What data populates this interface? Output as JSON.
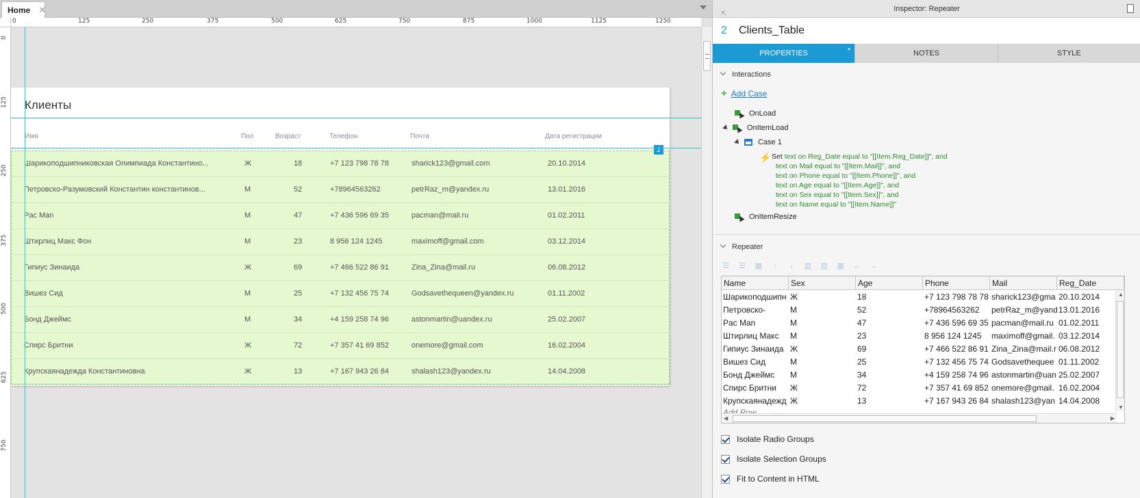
{
  "tabs": {
    "home_label": "Home",
    "close_glyph": "✕"
  },
  "rulers": {
    "horizontal": [
      "0",
      "125",
      "250",
      "375",
      "500",
      "625",
      "750",
      "875",
      "1000",
      "1125",
      "1250"
    ],
    "vertical": [
      "0",
      "125",
      "250",
      "375",
      "500",
      "625",
      "750"
    ]
  },
  "page": {
    "title": "Клиенты",
    "columns": [
      "Имя",
      "Пол",
      "Возраст",
      "Телефон",
      "Почта",
      "Дата регистрации"
    ],
    "badge": "2",
    "rows": [
      {
        "name": "Шарикоподшипниковская Олимпиада Константино...",
        "sex": "Ж",
        "age": "18",
        "phone": "+7 123 798 78 78",
        "mail": "sharick123@gmail.com",
        "date": "20.10.2014"
      },
      {
        "name": "Петровско-Разумовский Константин константинов...",
        "sex": "М",
        "age": "52",
        "phone": "+78964563262",
        "mail": "petrRaz_m@yandex.ru",
        "date": "13.01.2016"
      },
      {
        "name": "Pac Man",
        "sex": "М",
        "age": "47",
        "phone": "+7 436 596 69 35",
        "mail": "pacman@mail.ru",
        "date": "01.02.2011"
      },
      {
        "name": "Штирлиц Макс Фон",
        "sex": "М",
        "age": "23",
        "phone": "8 956 124 1245",
        "mail": "maximoff@gmail.com",
        "date": "03.12.2014"
      },
      {
        "name": "Гипиус Зинаида",
        "sex": "Ж",
        "age": "69",
        "phone": "+7 466 522 86 91",
        "mail": "Zina_Zina@mail.ru",
        "date": "06.08.2012"
      },
      {
        "name": "Вишез Сид",
        "sex": "М",
        "age": "25",
        "phone": "+7 132 456 75 74",
        "mail": "Godsavethequeen@yandex.ru",
        "date": "01.11.2002"
      },
      {
        "name": "Бонд Джеймс",
        "sex": "М",
        "age": "34",
        "phone": "+4 159 258 74 96",
        "mail": "astonmartin@uandex.ru",
        "date": "25.02.2007"
      },
      {
        "name": "Спирс Бритни",
        "sex": "Ж",
        "age": "72",
        "phone": "+7 357 41 69 852",
        "mail": "onemore@gmail.com",
        "date": "16.02.2004"
      },
      {
        "name": "Крупскаянадежда Константиновна",
        "sex": "Ж",
        "age": "13",
        "phone": "+7 167 943 26 84",
        "mail": "shalash123@yandex.ru",
        "date": "14.04.2008"
      }
    ]
  },
  "inspector": {
    "title": "Inspector: Repeater",
    "widget_number": "2",
    "widget_name": "Clients_Table",
    "tabs": [
      "PROPERTIES",
      "NOTES",
      "STYLE"
    ],
    "properties_star": "*",
    "interactions_label": "Interactions",
    "add_case": "Add Case",
    "events": {
      "onload": "OnLoad",
      "onitemload": "OnItemLoad",
      "case1": "Case 1",
      "onitemresize": "OnItemResize"
    },
    "action_set": "Set",
    "action_lines": [
      "text on Reg_Date equal to \"[[Item.Reg_Date]]\", and",
      "text on Mail equal to \"[[Item.Mail]]\", and",
      "text on Phone equal to \"[[Item.Phone]]\", and",
      "text on Age equal to \"[[Item.Age]]\", and",
      "text on Sex equal to \"[[Item.Sex]]\", and",
      "text on Name equal to \"[[Item.Name]]\""
    ],
    "repeater_label": "Repeater",
    "grid_columns": [
      "Name",
      "Sex",
      "Age",
      "Phone",
      "Mail",
      "Reg_Date"
    ],
    "grid_rows": [
      [
        "Шарикоподшипн",
        "Ж",
        "18",
        "+7 123 798 78 78",
        "sharick123@gma",
        "20.10.2014"
      ],
      [
        "Петровско-",
        "М",
        "52",
        "+78964563262",
        "petrRaz_m@yand",
        "13.01.2016"
      ],
      [
        "Pac Man",
        "М",
        "47",
        "+7 436 596 69 35",
        "pacman@mail.ru",
        "01.02.2011"
      ],
      [
        "Штирлиц Макс",
        "М",
        "23",
        "8 956 124 1245",
        "maximoff@gmail.",
        "03.12.2014"
      ],
      [
        "Гипиус Зинаида",
        "Ж",
        "69",
        "+7 466 522 86 91",
        "Zina_Zina@mail.r",
        "06.08.2012"
      ],
      [
        "Вишез Сид",
        "М",
        "25",
        "+7 132 456 75 74",
        "Godsavethequee",
        "01.11.2002"
      ],
      [
        "Бонд Джеймс",
        "М",
        "34",
        "+4 159 258 74 96",
        "astonmartin@uan",
        "25.02.2007"
      ],
      [
        "Спирс Бритни",
        "Ж",
        "72",
        "+7 357 41 69 852",
        "onemore@gmail.",
        "16.02.2004"
      ],
      [
        "Крупскаянадежд",
        "Ж",
        "13",
        "+7 167 943 26 84",
        "shalash123@yan",
        "14.04.2008"
      ]
    ],
    "add_row": "Add Row",
    "checkboxes": [
      "Isolate Radio Groups",
      "Isolate Selection Groups",
      "Fit to Content in HTML"
    ]
  }
}
